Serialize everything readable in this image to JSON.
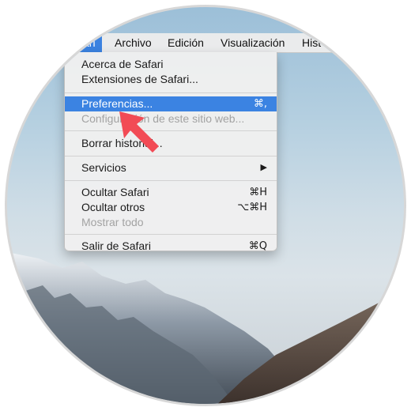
{
  "menubar": {
    "items": [
      {
        "label": "ari",
        "active": true
      },
      {
        "label": "Archivo"
      },
      {
        "label": "Edición"
      },
      {
        "label": "Visualización"
      },
      {
        "label": "Hist"
      }
    ]
  },
  "safari_menu": {
    "items": [
      {
        "label": "Acerca de Safari",
        "shortcut": "",
        "state": "enabled"
      },
      {
        "label": "Extensiones de Safari...",
        "shortcut": "",
        "state": "enabled"
      },
      {
        "label": "Preferencias...",
        "shortcut": "⌘,",
        "state": "highlighted"
      },
      {
        "label": "Configuración de este sitio web...",
        "shortcut": "",
        "state": "disabled"
      },
      {
        "label": "Borrar historial...",
        "shortcut": "",
        "state": "enabled"
      },
      {
        "label": "Servicios",
        "shortcut": "",
        "submenu": "▶",
        "state": "enabled"
      },
      {
        "label": "Ocultar Safari",
        "shortcut": "⌘H",
        "state": "enabled"
      },
      {
        "label": "Ocultar otros",
        "shortcut": "⌥⌘H",
        "state": "enabled"
      },
      {
        "label": "Mostrar todo",
        "shortcut": "",
        "state": "disabled"
      },
      {
        "label": "Salir de Safari",
        "shortcut": "⌘Q",
        "state": "enabled"
      }
    ]
  },
  "colors": {
    "highlight": "#3b83e2",
    "annotation_arrow": "#f24b55"
  },
  "icons": {
    "submenu_arrow": "triangle-right",
    "annotation": "red-pointer-arrow"
  }
}
